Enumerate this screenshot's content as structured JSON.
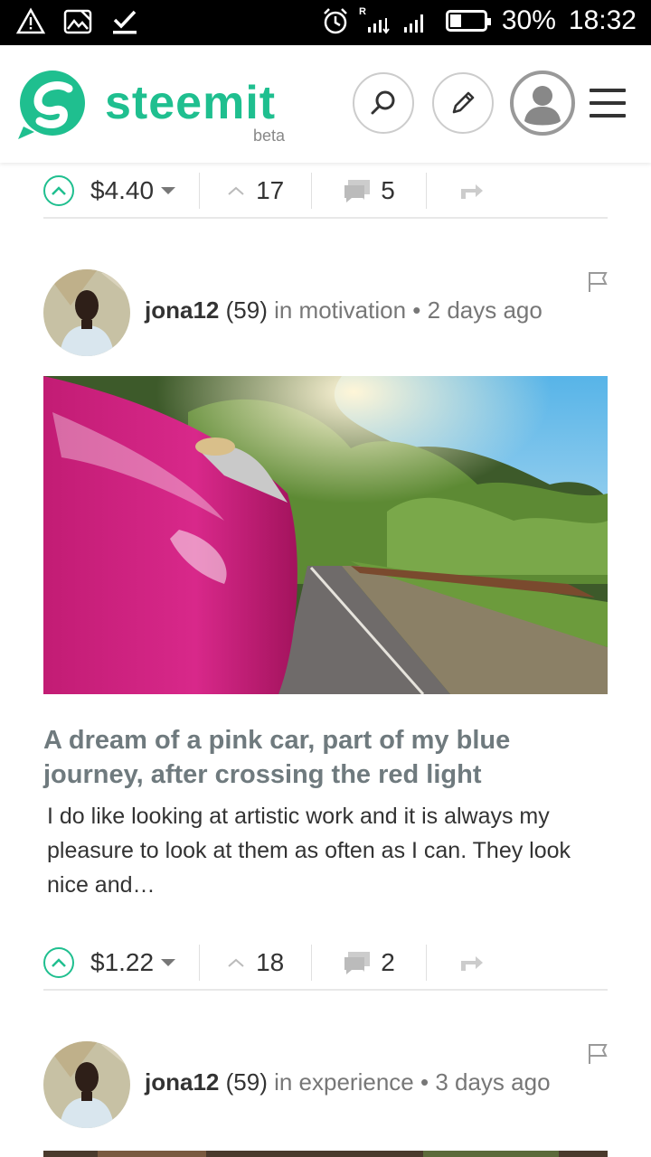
{
  "status_bar": {
    "battery": "30%",
    "time": "18:32"
  },
  "header": {
    "brand": "steemit",
    "badge": "beta",
    "brand_color": "#1fbf8f"
  },
  "prev_post": {
    "payout": "$4.40",
    "votes": "17",
    "comments": "5"
  },
  "posts": [
    {
      "author": "jona12",
      "reputation": "(59)",
      "community": "in motivation",
      "time": "2 days ago",
      "title": "A dream of a pink car, part of my blue journey, after crossing the red light",
      "excerpt": "I do like looking at artistic work and it is always my pleasure to look at them as often as I can. They look nice and…",
      "payout": "$1.22",
      "votes": "18",
      "comments": "2"
    },
    {
      "author": "jona12",
      "reputation": "(59)",
      "community": "in experience",
      "time": "3 days ago"
    }
  ],
  "icons": [
    "warning-icon",
    "image-icon",
    "check-download-icon",
    "alarm-icon",
    "signal-icon",
    "battery-icon",
    "search-icon",
    "pencil-icon",
    "user-icon",
    "menu-icon",
    "upvote-icon",
    "comment-icon",
    "reblog-icon",
    "flag-icon"
  ]
}
